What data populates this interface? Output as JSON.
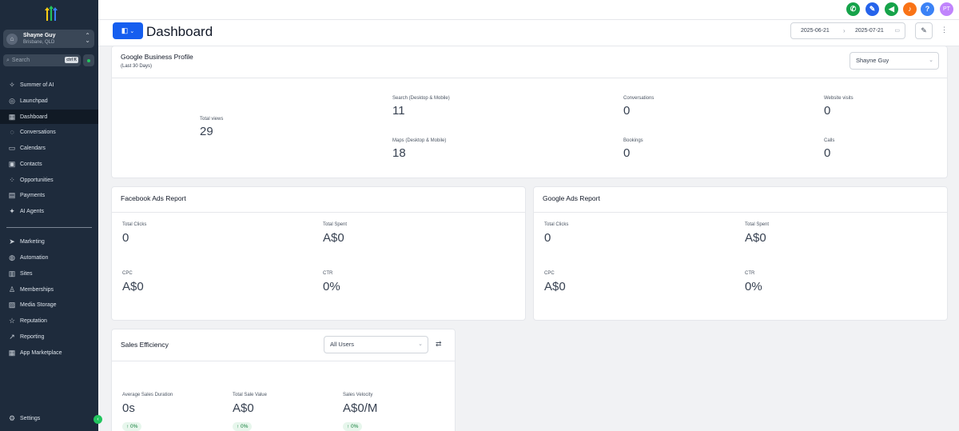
{
  "sidebar": {
    "account": {
      "name": "Shayne Guy",
      "location": "Brisbane, QLD"
    },
    "search": {
      "placeholder": "Search",
      "shortcut": "ctrl K"
    },
    "items": [
      {
        "label": "Summer of AI",
        "icon": "sparkle-icon"
      },
      {
        "label": "Launchpad",
        "icon": "rocket-icon"
      },
      {
        "label": "Dashboard",
        "icon": "grid-icon",
        "active": true
      },
      {
        "label": "Conversations",
        "icon": "chat-icon"
      },
      {
        "label": "Calendars",
        "icon": "calendar-icon"
      },
      {
        "label": "Contacts",
        "icon": "contacts-icon"
      },
      {
        "label": "Opportunities",
        "icon": "opportunities-icon"
      },
      {
        "label": "Payments",
        "icon": "payments-icon"
      },
      {
        "label": "AI Agents",
        "icon": "ai-sparkle-icon"
      },
      {
        "label": "Marketing",
        "icon": "send-icon"
      },
      {
        "label": "Automation",
        "icon": "automation-icon"
      },
      {
        "label": "Sites",
        "icon": "sites-icon"
      },
      {
        "label": "Memberships",
        "icon": "memberships-icon"
      },
      {
        "label": "Media Storage",
        "icon": "media-icon"
      },
      {
        "label": "Reputation",
        "icon": "star-icon"
      },
      {
        "label": "Reporting",
        "icon": "chart-line-icon"
      },
      {
        "label": "App Marketplace",
        "icon": "apps-icon"
      }
    ],
    "settings": "Settings"
  },
  "topbar": {
    "icons": [
      {
        "name": "phone-icon",
        "color": "#16a34a"
      },
      {
        "name": "wand-icon",
        "color": "#2563eb"
      },
      {
        "name": "megaphone-icon",
        "color": "#16a34a"
      },
      {
        "name": "bell-icon",
        "color": "#f97316"
      },
      {
        "name": "help-icon",
        "color": "#3b82f6"
      }
    ],
    "avatar": "PT",
    "avatar_color": "#c084fc"
  },
  "header": {
    "title": "Dashboard",
    "date_start": "2025-06-21",
    "date_end": "2025-07-21"
  },
  "google_business": {
    "title": "Google Business Profile",
    "subtitle": "(Last 30 Days)",
    "selected_user": "Shayne Guy",
    "total_views_label": "Total views",
    "total_views": "29",
    "metrics": [
      {
        "label": "Search (Desktop & Mobile)",
        "value": "11"
      },
      {
        "label": "Conversations",
        "value": "0"
      },
      {
        "label": "Website visits",
        "value": "0"
      },
      {
        "label": "Maps (Desktop & Mobile)",
        "value": "18"
      },
      {
        "label": "Bookings",
        "value": "0"
      },
      {
        "label": "Calls",
        "value": "0"
      }
    ]
  },
  "facebook_ads": {
    "title": "Facebook Ads Report",
    "metrics": [
      {
        "label": "Total Clicks",
        "value": "0"
      },
      {
        "label": "Total Spent",
        "value": "A$0"
      },
      {
        "label": "CPC",
        "value": "A$0"
      },
      {
        "label": "CTR",
        "value": "0%"
      }
    ]
  },
  "google_ads": {
    "title": "Google Ads Report",
    "metrics": [
      {
        "label": "Total Clicks",
        "value": "0"
      },
      {
        "label": "Total Spent",
        "value": "A$0"
      },
      {
        "label": "CPC",
        "value": "A$0"
      },
      {
        "label": "CTR",
        "value": "0%"
      }
    ]
  },
  "sales_efficiency": {
    "title": "Sales Efficiency",
    "user_filter": "All Users",
    "metrics": [
      {
        "label": "Average Sales Duration",
        "value": "0s",
        "change": "↑ 0%"
      },
      {
        "label": "Total Sale Value",
        "value": "A$0",
        "change": "↑ 0%"
      },
      {
        "label": "Sales Velocity",
        "value": "A$0/M",
        "change": "↑ 0%"
      }
    ]
  }
}
